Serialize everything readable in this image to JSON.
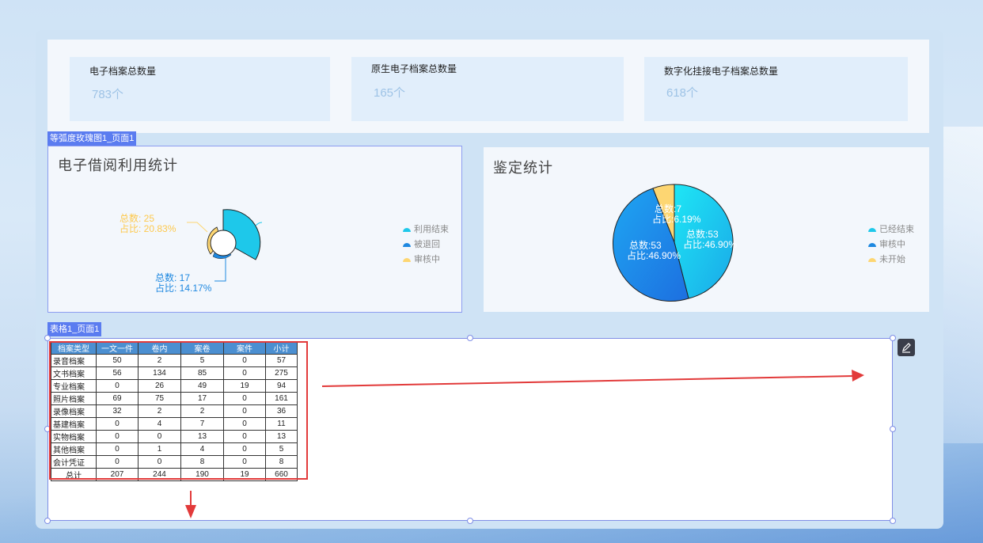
{
  "kpis": [
    {
      "title": "电子档案总数量",
      "value": "783个"
    },
    {
      "title": "原生电子档案总数量",
      "value": "165个"
    },
    {
      "title": "数字化挂接电子档案总数量",
      "value": "618个"
    }
  ],
  "rose_panel": {
    "tag": "等弧度玫瑰图1_页面1",
    "title": "电子借阅利用统计",
    "label_top": {
      "line1": "总数: 25",
      "line2": "占比: 20.83%"
    },
    "label_bottom": {
      "line1": "总数: 17",
      "line2": "占比: 14.17%"
    },
    "legend": [
      {
        "label": "利用结束",
        "color": "#1ec8ea"
      },
      {
        "label": "被退回",
        "color": "#1e88e0"
      },
      {
        "label": "审核中",
        "color": "#fdd672"
      }
    ]
  },
  "pie_panel": {
    "title": "鉴定统计",
    "label_small": {
      "line1": "总数:7",
      "line2": "占比:6.19%"
    },
    "label_right": {
      "line1": "总数:53",
      "line2": "占比:46.90%"
    },
    "label_left": {
      "line1": "总数:53",
      "line2": "占比:46.90%"
    },
    "legend": [
      {
        "label": "已经结束",
        "color": "#1ec8ea"
      },
      {
        "label": "审核中",
        "color": "#1e88e0"
      },
      {
        "label": "未开始",
        "color": "#fdd672"
      }
    ]
  },
  "chart_data": [
    {
      "type": "pie",
      "title": "电子借阅利用统计",
      "categories": [
        "利用结束",
        "被退回",
        "审核中"
      ],
      "values": [
        25,
        17,
        25
      ],
      "percent_labels": [
        "20.83%",
        "14.17%"
      ],
      "legend": "right"
    },
    {
      "type": "pie",
      "title": "鉴定统计",
      "categories": [
        "已经结束",
        "审核中",
        "未开始"
      ],
      "values": [
        53,
        53,
        7
      ],
      "percent_labels": [
        "46.90%",
        "46.90%",
        "6.19%"
      ],
      "legend": "right"
    }
  ],
  "table": {
    "tag": "表格1_页面1",
    "headers": [
      "档案类型",
      "一文一件",
      "卷内",
      "案卷",
      "案件",
      "小计"
    ],
    "rows": [
      [
        "录音档案",
        "50",
        "2",
        "5",
        "0",
        "57"
      ],
      [
        "文书档案",
        "56",
        "134",
        "85",
        "0",
        "275"
      ],
      [
        "专业档案",
        "0",
        "26",
        "49",
        "19",
        "94"
      ],
      [
        "照片档案",
        "69",
        "75",
        "17",
        "0",
        "161"
      ],
      [
        "录像档案",
        "32",
        "2",
        "2",
        "0",
        "36"
      ],
      [
        "基建档案",
        "0",
        "4",
        "7",
        "0",
        "11"
      ],
      [
        "实物档案",
        "0",
        "0",
        "13",
        "0",
        "13"
      ],
      [
        "其他档案",
        "0",
        "1",
        "4",
        "0",
        "5"
      ],
      [
        "会计凭证",
        "0",
        "0",
        "8",
        "0",
        "8"
      ],
      [
        "总计",
        "207",
        "244",
        "190",
        "19",
        "660"
      ]
    ]
  },
  "icons": {
    "edit": "pencil-icon"
  },
  "colors": {
    "accent": "#5b7cf0",
    "annotation": "#e23a3a"
  }
}
